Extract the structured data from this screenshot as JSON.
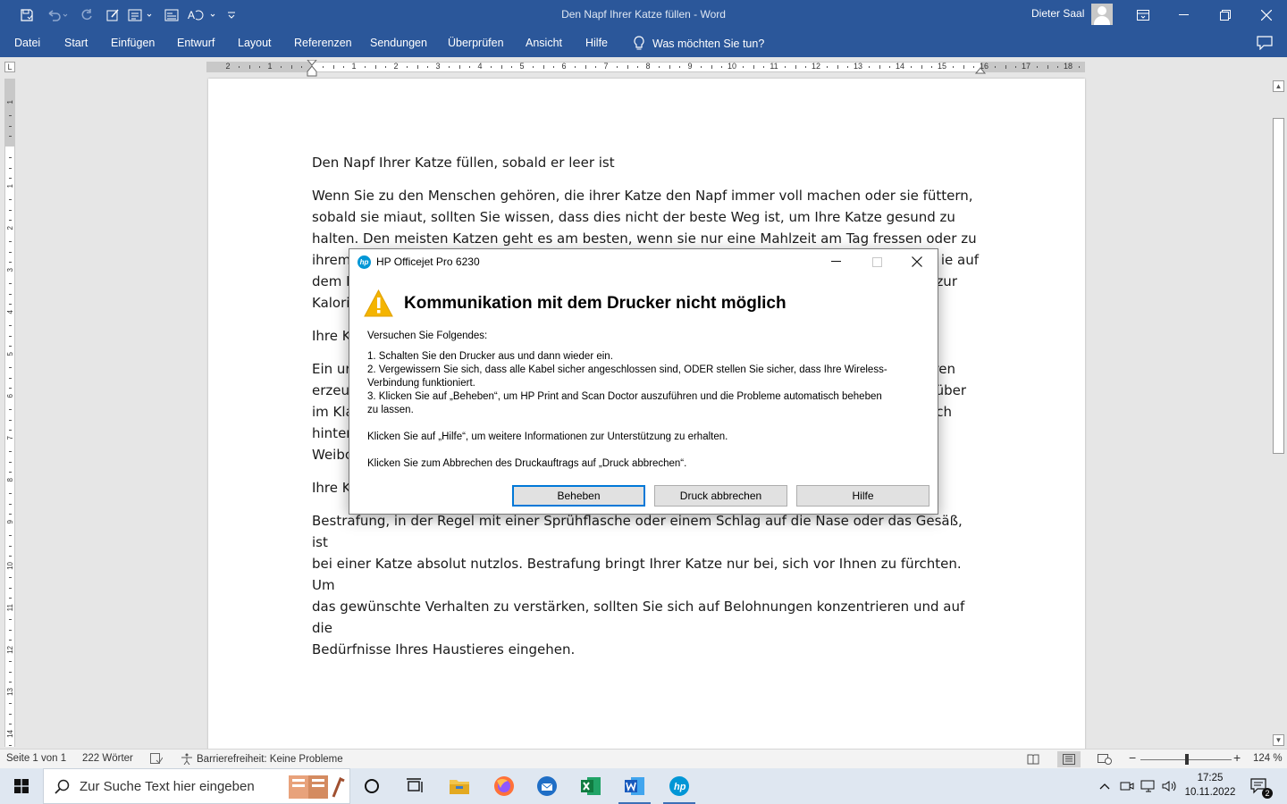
{
  "titlebar": {
    "doc_title": "Den Napf Ihrer Katze füllen  -  Word",
    "user": "Dieter Saal"
  },
  "menu": [
    "Datei",
    "Start",
    "Einfügen",
    "Entwurf",
    "Layout",
    "Referenzen",
    "Sendungen",
    "Überprüfen",
    "Ansicht",
    "Hilfe"
  ],
  "tell_me": "Was möchten Sie tun?",
  "ruler": {
    "labels": [
      "2",
      "1",
      "1",
      "2",
      "3",
      "4",
      "5",
      "6",
      "7",
      "8",
      "9",
      "10",
      "11",
      "12",
      "13",
      "14",
      "15",
      "16",
      "17",
      "18"
    ]
  },
  "document": {
    "paragraphs": [
      "Den Napf Ihrer Katze füllen, sobald er leer ist",
      "Wenn Sie zu den Menschen gehören, die ihrer Katze den Napf immer voll machen oder sie füttern, sobald sie miaut, sollten Sie wissen, dass dies nicht der beste Weg ist, um Ihre Katze gesund zu halten. Den meisten Katzen geht es am besten, wenn sie nur eine Mahlzeit am Tag fressen oder zu ihrem … ie auf dem … zur Kalori…",
      "Ihre K…",
      "Ein ur… ren erzeu… über im Kla… ch hinter… Weibc…",
      "Ihre K…",
      "Bestrafung, in der Regel mit einer Sprühflasche oder einem Schlag auf die Nase oder das Gesäß, ist bei einer Katze absolut nutzlos. Bestrafung bringt Ihrer Katze nur bei, sich vor Ihnen zu fürchten. Um das gewünschte Verhalten zu verstärken, sollten Sie sich auf Belohnungen konzentrieren und auf die Bedürfnisse Ihres Haustieres eingehen."
    ],
    "visible_lines": {
      "p1": "Den Napf Ihrer Katze füllen, sobald er leer ist",
      "p2_l1": "Wenn Sie zu den Menschen gehören, die ihrer Katze den Napf immer voll machen oder sie füttern,",
      "p2_l2": "sobald sie miaut, sollten Sie wissen, dass dies nicht der beste Weg ist, um Ihre Katze gesund zu",
      "p2_l3": "halten. Den meisten Katzen geht es am besten, wenn sie nur eine Mahlzeit am Tag fressen oder zu",
      "p2_l4a": "ihrem",
      "p2_l4b": "ie auf",
      "p2_l5a": "dem F",
      "p2_l5b": "zur",
      "p2_l6a": "Kalori",
      "p3": "Ihre K",
      "p4_l1a": "Ein ur",
      "p4_l1b": "ren",
      "p4_l2a": "erzeu",
      "p4_l2b": "über",
      "p4_l3a": "im Kla",
      "p4_l3b": "ch",
      "p4_l4a": "hinter",
      "p4_l5a": "Weibc",
      "p5": "Ihre K",
      "p6_l1": "Bestrafung, in der Regel mit einer Sprühflasche oder einem Schlag auf die Nase oder das Gesäß, ist",
      "p6_l2": "bei einer Katze absolut nutzlos. Bestrafung bringt Ihrer Katze nur bei, sich vor Ihnen zu fürchten. Um",
      "p6_l3": "das gewünschte Verhalten zu verstärken, sollten Sie sich auf Belohnungen konzentrieren und auf die",
      "p6_l4": "Bedürfnisse Ihres Haustieres eingehen."
    }
  },
  "statusbar": {
    "page": "Seite 1 von 1",
    "words": "222 Wörter",
    "accessibility": "Barrierefreiheit: Keine Probleme",
    "zoom": "124 %",
    "zoom_level_percent": 124
  },
  "dialog": {
    "title": "HP Officejet Pro 6230",
    "heading": "Kommunikation mit dem Drucker nicht möglich",
    "intro": "Versuchen Sie Folgendes:",
    "step1": "1. Schalten Sie den Drucker aus und dann wieder ein.",
    "step2a": "2. Vergewissern Sie sich, dass alle Kabel sicher angeschlossen sind, ODER stellen Sie sicher, dass Ihre Wireless-",
    "step2b": "Verbindung funktioniert.",
    "step3a": "3. Klicken Sie auf „Beheben“, um HP Print and Scan Doctor auszuführen und die Probleme automatisch beheben",
    "step3b": "zu lassen.",
    "help_text": "Klicken Sie auf „Hilfe“, um weitere Informationen zur Unterstützung zu erhalten.",
    "cancel_text": "Klicken Sie zum Abbrechen des Druckauftrags auf „Druck abbrechen“.",
    "buttons": {
      "fix": "Beheben",
      "cancel_print": "Druck abbrechen",
      "help": "Hilfe"
    }
  },
  "taskbar": {
    "search_placeholder": "Zur Suche Text hier eingeben",
    "time": "17:25",
    "date": "10.11.2022",
    "notifications": "2"
  },
  "colors": {
    "word_blue": "#2b579a",
    "warning_yellow": "#f4b400",
    "default_button_border": "#0078d7",
    "hp_blue": "#0096d6"
  },
  "icons": [
    "save-icon",
    "undo-icon",
    "redo-icon",
    "lightbulb-icon",
    "comment-icon",
    "warning-icon",
    "hp-logo-icon",
    "windows-start-icon",
    "search-icon"
  ]
}
